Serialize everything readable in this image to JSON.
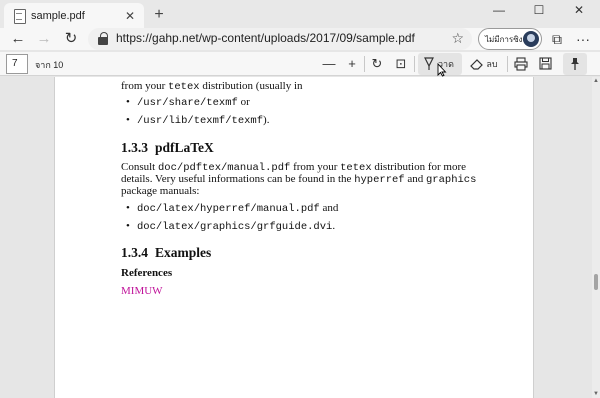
{
  "browser": {
    "tab_title": "sample.pdf",
    "tab_close": "✕",
    "new_tab": "+",
    "url": "https://gahp.net/wp-content/uploads/2017/09/sample.pdf",
    "profile_label": "ไม่มีการซิงค์",
    "window_controls": {
      "minimize": "—",
      "maximize": "☐",
      "close": "✕"
    },
    "nav": {
      "back": "←",
      "forward": "→",
      "refresh": "↻",
      "favorite": "☆",
      "collections": "⧉",
      "menu": "···"
    }
  },
  "pdf_toolbar": {
    "page_current": "7",
    "page_total": "จาก 10",
    "zoom_out": "—",
    "zoom_in": "+",
    "rotate": "↻",
    "fit_page": "⊡",
    "draw_label": "วาด",
    "erase_label": "ลบ",
    "print": "⎙",
    "save": "💾",
    "pin": "📌"
  },
  "document": {
    "line1_a": "from your ",
    "line1_code": "tetex",
    "line1_b": " distribution (usually in",
    "bullet1_code": "/usr/share/texmf",
    "bullet1_b": " or",
    "bullet2_code": "/usr/lib/texmf/texmf",
    "bullet2_b": ").",
    "section_133_num": "1.3.3",
    "section_133_title": "pdfLaTeX",
    "para_a": "Consult ",
    "para_code1": "doc/pdftex/manual.pdf",
    "para_b": " from your ",
    "para_code2": "tetex",
    "para_c": " distribution for more",
    "para2_a": "details. Very useful informations can be found in the ",
    "para2_code1": "hyperref",
    "para2_b": " and ",
    "para2_code2": "graphics",
    "para3": "package manuals:",
    "bullet3_code": "doc/latex/hyperref/manual.pdf",
    "bullet3_b": " and",
    "bullet4_code": "doc/latex/graphics/grfguide.dvi",
    "bullet4_b": ".",
    "section_134_num": "1.3.4",
    "section_134_title": "Examples",
    "references": "References",
    "link": "MIMUW"
  },
  "scrollbar": {
    "up": "▲",
    "down": "▼"
  },
  "colors": {
    "link": "#c0139a",
    "accent": "#2a3d5c"
  }
}
